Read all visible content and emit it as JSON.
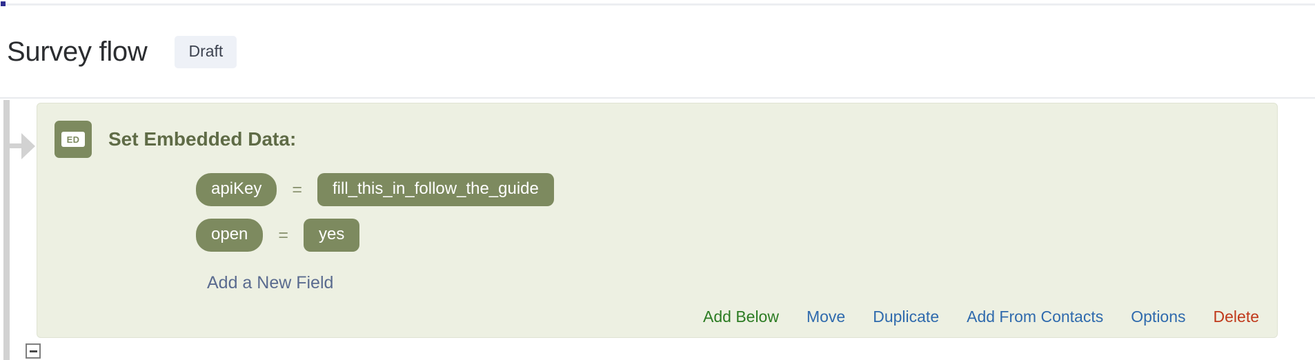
{
  "header": {
    "title": "Survey flow",
    "status_badge": "Draft",
    "badge_bg": "#eef1f7",
    "badge_text_color": "#3d4350"
  },
  "colors": {
    "card_bg": "#edf0e2",
    "card_border": "#dfe3d2",
    "pill_bg": "#7d8a5f",
    "pill_text": "#ffffff",
    "title_text": "#5f6b46",
    "link_blue": "#2f6aad",
    "link_green": "#2c7c23",
    "link_red": "#c0391b",
    "add_field_link": "#5a6b8f",
    "rail_gray": "#d2d2d2"
  },
  "block": {
    "icon_label": "ED",
    "icon_name": "embedded-data-icon",
    "title": "Set Embedded Data:",
    "fields": [
      {
        "key": "apiKey",
        "operator": "=",
        "value": "fill_this_in_follow_the_guide"
      },
      {
        "key": "open",
        "operator": "=",
        "value": "yes"
      }
    ],
    "add_field_label": "Add a New Field",
    "actions": [
      {
        "label": "Add Below",
        "style": "green"
      },
      {
        "label": "Move",
        "style": "blue"
      },
      {
        "label": "Duplicate",
        "style": "blue"
      },
      {
        "label": "Add From Contacts",
        "style": "blue"
      },
      {
        "label": "Options",
        "style": "blue"
      },
      {
        "label": "Delete",
        "style": "red"
      }
    ]
  },
  "canvas": {
    "collapse_toggle_name": "collapse-block-toggle",
    "flow_arrow_name": "flow-arrow-icon"
  }
}
